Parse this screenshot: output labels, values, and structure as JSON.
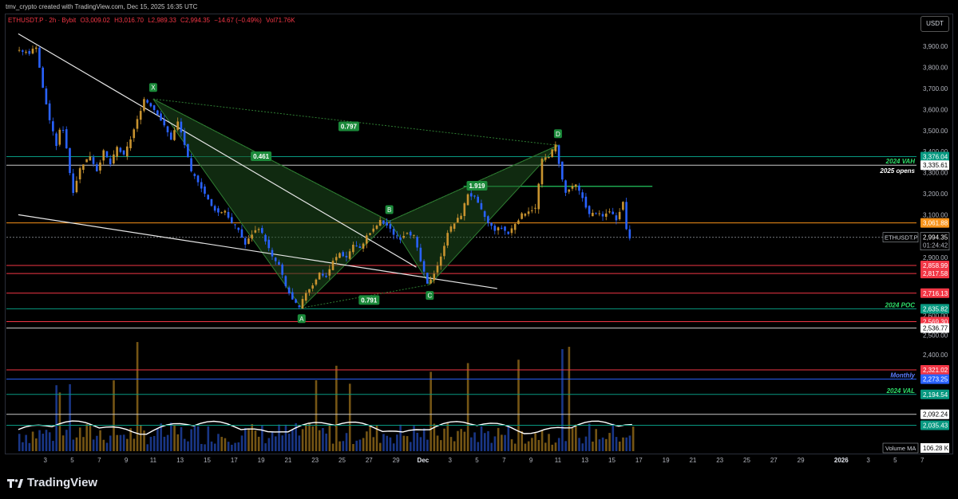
{
  "header": {
    "credit": "tmv_crypto created with TradingView.com, Dec 15, 2025 16:35 UTC"
  },
  "symbol_bar": {
    "name": "ETHUSDT.P · 2h · Bybit",
    "o": "O3,009.02",
    "h": "H3,016.70",
    "l": "L2,989.33",
    "c": "C2,994.35",
    "chg": "−14.67 (−0.49%)",
    "vol": "Vol71.76K"
  },
  "price_scale": {
    "unit": "USDT"
  },
  "footer": {
    "brand": "TradingView"
  },
  "colors": {
    "background": "#000000",
    "bull": "#c8932f",
    "bear": "#2962ff",
    "level_green": "#089981",
    "level_red": "#f23645",
    "pattern_fill": "#1e4d1e",
    "label_green": "#1b8a3a"
  },
  "chart_data": {
    "type": "candlestick",
    "y_axis": {
      "min": 2000,
      "max": 4000,
      "grid": false,
      "ticks": [
        "3,900.00",
        "3,800.00",
        "3,700.00",
        "3,600.00",
        "3,500.00",
        "3,400.00",
        "3,300.00",
        "3,200.00",
        "3,100.00",
        "2,900.00",
        "2,600.00",
        "2,500.00",
        "2,400.00"
      ]
    },
    "x_axis": {
      "labels": [
        {
          "label": "3",
          "day": 3
        },
        {
          "label": "5",
          "day": 5
        },
        {
          "label": "7",
          "day": 7
        },
        {
          "label": "9",
          "day": 9
        },
        {
          "label": "11",
          "day": 11
        },
        {
          "label": "13",
          "day": 13
        },
        {
          "label": "15",
          "day": 15
        },
        {
          "label": "17",
          "day": 17
        },
        {
          "label": "19",
          "day": 19
        },
        {
          "label": "21",
          "day": 21
        },
        {
          "label": "23",
          "day": 23
        },
        {
          "label": "25",
          "day": 25
        },
        {
          "label": "27",
          "day": 27
        },
        {
          "label": "29",
          "day": 29
        },
        {
          "label": "Dec",
          "day": 31
        },
        {
          "label": "3",
          "day": 33
        },
        {
          "label": "5",
          "day": 35
        },
        {
          "label": "7",
          "day": 37
        },
        {
          "label": "9",
          "day": 39
        },
        {
          "label": "11",
          "day": 41
        },
        {
          "label": "13",
          "day": 43
        },
        {
          "label": "15",
          "day": 45
        },
        {
          "label": "17",
          "day": 47
        },
        {
          "label": "19",
          "day": 49
        },
        {
          "label": "21",
          "day": 51
        },
        {
          "label": "23",
          "day": 53
        },
        {
          "label": "25",
          "day": 55
        },
        {
          "label": "27",
          "day": 57
        },
        {
          "label": "29",
          "day": 59
        },
        {
          "label": "2026",
          "day": 62
        },
        {
          "label": "3",
          "day": 64
        },
        {
          "label": "5",
          "day": 66
        },
        {
          "label": "7",
          "day": 68
        }
      ]
    },
    "price_path": [
      {
        "day": 1,
        "price": 3880
      },
      {
        "day": 2,
        "price": 3870
      },
      {
        "day": 2.5,
        "price": 3900
      },
      {
        "day": 3,
        "price": 3700
      },
      {
        "day": 3.5,
        "price": 3550
      },
      {
        "day": 4,
        "price": 3430
      },
      {
        "day": 4.4,
        "price": 3540
      },
      {
        "day": 4.8,
        "price": 3400
      },
      {
        "day": 5.2,
        "price": 3200
      },
      {
        "day": 5.8,
        "price": 3330
      },
      {
        "day": 6.5,
        "price": 3380
      },
      {
        "day": 7,
        "price": 3310
      },
      {
        "day": 7.5,
        "price": 3400
      },
      {
        "day": 8,
        "price": 3340
      },
      {
        "day": 8.5,
        "price": 3420
      },
      {
        "day": 9,
        "price": 3380
      },
      {
        "day": 9.5,
        "price": 3460
      },
      {
        "day": 10,
        "price": 3550
      },
      {
        "day": 10.5,
        "price": 3650
      },
      {
        "day": 11,
        "price": 3620
      },
      {
        "day": 11.5,
        "price": 3580
      },
      {
        "day": 12,
        "price": 3520
      },
      {
        "day": 12.5,
        "price": 3460
      },
      {
        "day": 13,
        "price": 3540
      },
      {
        "day": 13.4,
        "price": 3460
      },
      {
        "day": 14,
        "price": 3300
      },
      {
        "day": 14.5,
        "price": 3260
      },
      {
        "day": 15,
        "price": 3200
      },
      {
        "day": 15.5,
        "price": 3140
      },
      {
        "day": 16,
        "price": 3110
      },
      {
        "day": 16.5,
        "price": 3120
      },
      {
        "day": 17,
        "price": 3060
      },
      {
        "day": 17.5,
        "price": 3030
      },
      {
        "day": 18,
        "price": 2960
      },
      {
        "day": 18.5,
        "price": 3010
      },
      {
        "day": 19,
        "price": 3040
      },
      {
        "day": 19.5,
        "price": 2980
      },
      {
        "day": 20,
        "price": 2900
      },
      {
        "day": 20.5,
        "price": 2860
      },
      {
        "day": 21,
        "price": 2750
      },
      {
        "day": 21.5,
        "price": 2680
      },
      {
        "day": 22,
        "price": 2640
      },
      {
        "day": 22.5,
        "price": 2720
      },
      {
        "day": 23,
        "price": 2760
      },
      {
        "day": 23.5,
        "price": 2820
      },
      {
        "day": 24,
        "price": 2800
      },
      {
        "day": 24.5,
        "price": 2880
      },
      {
        "day": 25,
        "price": 2920
      },
      {
        "day": 25.5,
        "price": 2900
      },
      {
        "day": 26,
        "price": 2960
      },
      {
        "day": 26.5,
        "price": 2940
      },
      {
        "day": 27,
        "price": 3000
      },
      {
        "day": 27.5,
        "price": 3030
      },
      {
        "day": 28,
        "price": 3070
      },
      {
        "day": 28.5,
        "price": 3050
      },
      {
        "day": 29,
        "price": 3010
      },
      {
        "day": 29.5,
        "price": 2990
      },
      {
        "day": 30,
        "price": 3020
      },
      {
        "day": 30.5,
        "price": 3000
      },
      {
        "day": 31,
        "price": 2880
      },
      {
        "day": 31.5,
        "price": 2760
      },
      {
        "day": 32,
        "price": 2820
      },
      {
        "day": 32.5,
        "price": 2900
      },
      {
        "day": 33,
        "price": 3020
      },
      {
        "day": 33.5,
        "price": 3060
      },
      {
        "day": 34,
        "price": 3100
      },
      {
        "day": 34.5,
        "price": 3200
      },
      {
        "day": 35,
        "price": 3180
      },
      {
        "day": 35.5,
        "price": 3120
      },
      {
        "day": 36,
        "price": 3060
      },
      {
        "day": 36.5,
        "price": 3030
      },
      {
        "day": 37,
        "price": 3040
      },
      {
        "day": 37.5,
        "price": 3010
      },
      {
        "day": 38,
        "price": 3060
      },
      {
        "day": 38.5,
        "price": 3100
      },
      {
        "day": 39,
        "price": 3120
      },
      {
        "day": 39.5,
        "price": 3130
      },
      {
        "day": 40,
        "price": 3360
      },
      {
        "day": 40.5,
        "price": 3380
      },
      {
        "day": 41,
        "price": 3430
      },
      {
        "day": 41.3,
        "price": 3330
      },
      {
        "day": 41.7,
        "price": 3200
      },
      {
        "day": 42,
        "price": 3220
      },
      {
        "day": 42.5,
        "price": 3240
      },
      {
        "day": 43,
        "price": 3180
      },
      {
        "day": 43.5,
        "price": 3100
      },
      {
        "day": 44,
        "price": 3110
      },
      {
        "day": 44.5,
        "price": 3090
      },
      {
        "day": 45,
        "price": 3120
      },
      {
        "day": 45.5,
        "price": 3080
      },
      {
        "day": 46,
        "price": 3160
      },
      {
        "day": 46.3,
        "price": 3010
      },
      {
        "day": 46.5,
        "price": 2994
      }
    ],
    "pattern": {
      "points": [
        {
          "label": "X",
          "day": 11,
          "price": 3650
        },
        {
          "label": "A",
          "day": 22,
          "price": 2640
        },
        {
          "label": "B",
          "day": 28.5,
          "price": 3070
        },
        {
          "label": "C",
          "day": 31.5,
          "price": 2760
        },
        {
          "label": "D",
          "day": 41,
          "price": 3430
        }
      ],
      "ratios": [
        {
          "label": "0.461",
          "day": 19,
          "price": 3378
        },
        {
          "label": "0.797",
          "day": 25.5,
          "price": 3520
        },
        {
          "label": "1.919",
          "day": 35,
          "price": 3238
        },
        {
          "label": "0.791",
          "day": 27,
          "price": 2681
        }
      ]
    },
    "trendlines": [
      {
        "from": {
          "day": 1,
          "price": 3960
        },
        "to": {
          "day": 30.5,
          "price": 2850
        }
      },
      {
        "from": {
          "day": 1,
          "price": 3100
        },
        "to": {
          "day": 36.5,
          "price": 2740
        }
      }
    ],
    "horizontal_levels": [
      {
        "price": 3376.04,
        "label": "3,376.04",
        "color": "#089981",
        "text": ""
      },
      {
        "price": 3335.61,
        "label": "3,335.61",
        "color": "#c8c8c8",
        "text": "2024 VAH",
        "text_color": "#2ee06a"
      },
      {
        "price": 3335.61,
        "label": "",
        "color": "",
        "text": "2025 opens",
        "text_color": "#ffffff"
      },
      {
        "price": 3061.88,
        "label": "3,061.88",
        "color": "#f7931a",
        "text": ""
      },
      {
        "price": 2858.99,
        "label": "2,858.99",
        "color": "#f23645",
        "text": ""
      },
      {
        "price": 2817.58,
        "label": "2,817.58",
        "color": "#f23645",
        "text": ""
      },
      {
        "price": 2716.13,
        "label": "2,716.13",
        "color": "#f23645",
        "text": ""
      },
      {
        "price": 2635.82,
        "label": "2,635.82",
        "color": "#089981",
        "text": "2024 POC",
        "text_color": "#2ee06a"
      },
      {
        "price": 2569.3,
        "label": "2,569.30",
        "color": "#f23645",
        "text": ""
      },
      {
        "price": 2536.77,
        "label": "2,536.77",
        "color": "#c8c8c8",
        "text": ""
      },
      {
        "price": 2321.02,
        "label": "2,321.02",
        "color": "#f23645",
        "text": ""
      },
      {
        "price": 2273.25,
        "label": "2,273.25",
        "color": "#2962ff",
        "text": "Monthly",
        "text_color": "#5b7cff"
      },
      {
        "price": 2194.54,
        "label": "2,194.54",
        "color": "#089981",
        "text": "2024 VAL",
        "text_color": "#2ee06a"
      },
      {
        "price": 2092.24,
        "label": "2,092.24",
        "color": "#c8c8c8",
        "text": ""
      },
      {
        "price": 2035.43,
        "label": "2,035.43",
        "color": "#089981",
        "text": ""
      }
    ],
    "resistance_segment": {
      "from_day": 34,
      "to_day": 48,
      "price": 3235
    },
    "current_price": {
      "symbol": "ETHUSDT.P",
      "price": 2994.35,
      "label": "2,994.35",
      "countdown": "01:24:42"
    },
    "volume": {
      "label": "Volume MA",
      "value": "106.28 K"
    }
  }
}
